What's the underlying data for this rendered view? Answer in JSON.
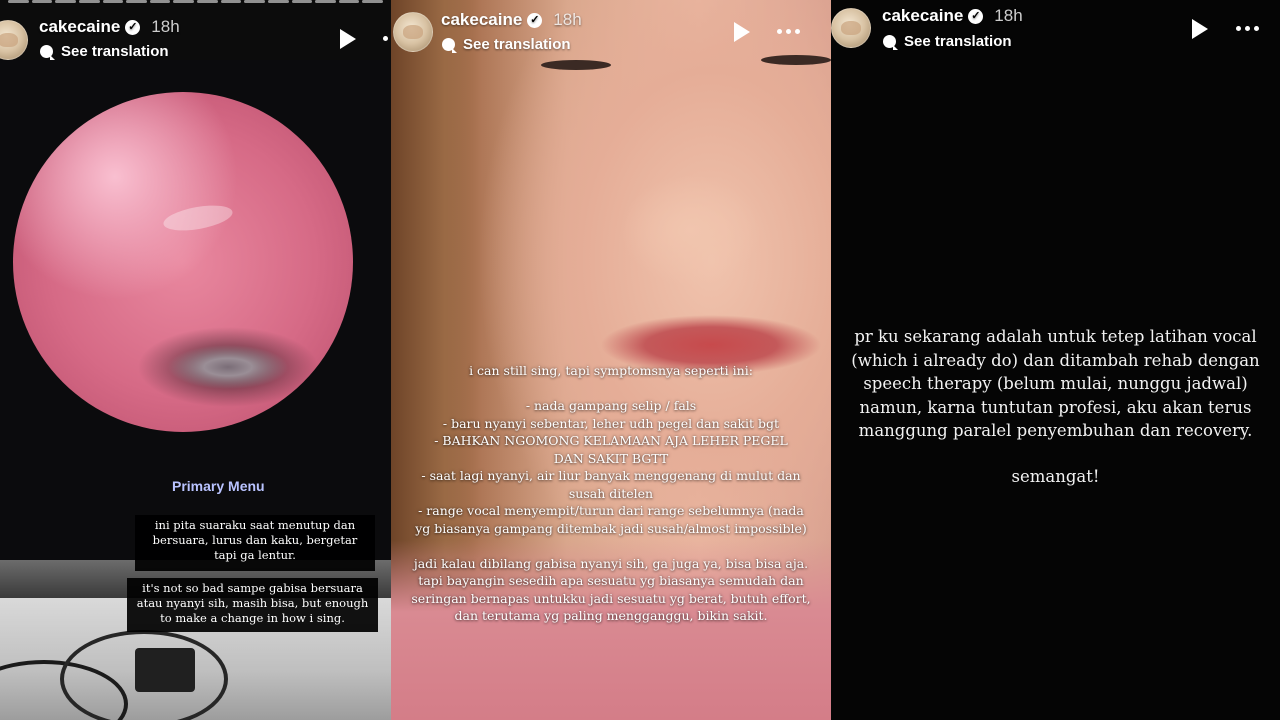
{
  "stories": [
    {
      "username": "cakecaine",
      "time": "18h",
      "translate_label": "See translation",
      "screen_menu_label": "Primary Menu",
      "captions": [
        "ini pita suaraku saat menutup dan bersuara, lurus dan kaku, bergetar tapi ga lentur.",
        "it's not so bad sampe gabisa bersuara atau nyanyi sih, masih bisa, but enough to make a change in how i sing."
      ]
    },
    {
      "username": "cakecaine",
      "time": "18h",
      "translate_label": "See translation",
      "text_lines": [
        "i can still sing, tapi symptomsnya seperti ini:",
        "- nada gampang selip / fals",
        "- baru nyanyi sebentar, leher udh pegel dan sakit bgt",
        "- BAHKAN NGOMONG KELAMAAN AJA LEHER PEGEL",
        "DAN SAKIT BGTT",
        "- saat lagi nyanyi, air liur banyak menggenang di mulut dan",
        "susah ditelen",
        "- range vocal menyempit/turun dari range sebelumnya (nada",
        "yg biasanya gampang ditembak jadi susah/almost impossible)",
        "jadi kalau dibilang gabisa nyanyi sih, ga juga ya, bisa bisa aja.",
        "tapi bayangin sesedih apa sesuatu yg biasanya semudah dan",
        "seringan bernapas untukku jadi sesuatu yg berat, butuh effort,",
        "dan terutama yg paling mengganggu, bikin sakit."
      ]
    },
    {
      "username": "cakecaine",
      "time": "18h",
      "translate_label": "See translation",
      "text_lines": [
        "pr ku sekarang adalah untuk tetep latihan vocal",
        "(which i already do) dan ditambah rehab dengan",
        "speech therapy (belum mulai, nunggu jadwal)",
        "namun, karna tuntutan profesi, aku akan terus",
        "manggung paralel penyembuhan dan recovery.",
        "semangat!"
      ]
    }
  ],
  "icons": {
    "play": "play-icon",
    "more": "more-options-icon",
    "verified": "verified-badge-icon",
    "translate": "translate-icon"
  },
  "colors": {
    "screen_menu_text": "#b9c3ff",
    "caption_bg": "#000000",
    "story_text": "#ffffff"
  }
}
